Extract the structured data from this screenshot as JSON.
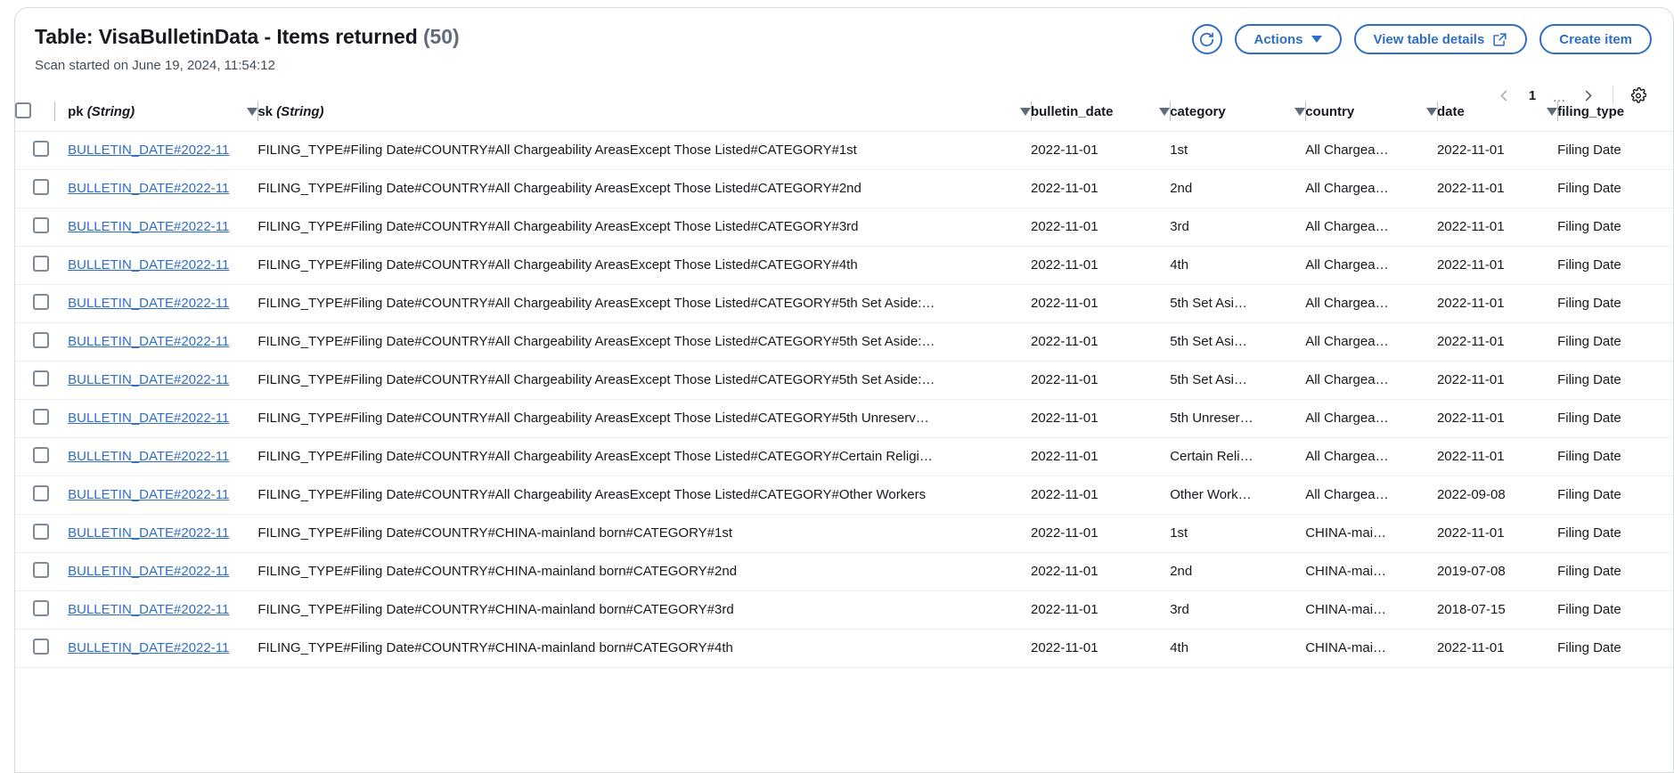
{
  "header": {
    "title_prefix": "Table: VisaBulletinData - Items returned",
    "item_count": "(50)",
    "subtitle": "Scan started on June 19, 2024, 11:54:12",
    "refresh_label": "",
    "actions_label": "Actions",
    "view_table_details_label": "View table details",
    "create_item_label": "Create item"
  },
  "pagination": {
    "prev_label": "",
    "page": "1",
    "ellipsis": "…",
    "next_label": "",
    "settings_label": ""
  },
  "table": {
    "columns": [
      {
        "key": "pk",
        "label": "pk ",
        "type": "(String)"
      },
      {
        "key": "sk",
        "label": "sk ",
        "type": "(String)"
      },
      {
        "key": "bulletin_date",
        "label": "bulletin_date",
        "type": ""
      },
      {
        "key": "category",
        "label": "category",
        "type": ""
      },
      {
        "key": "country",
        "label": "country",
        "type": ""
      },
      {
        "key": "date",
        "label": "date",
        "type": ""
      },
      {
        "key": "filing_type",
        "label": "filing_type",
        "type": ""
      }
    ],
    "rows": [
      {
        "pk": "BULLETIN_DATE#2022-11",
        "sk": "FILING_TYPE#Filing Date#COUNTRY#All Chargeability AreasExcept Those Listed#CATEGORY#1st",
        "bulletin_date": "2022-11-01",
        "category": "1st",
        "country": "All Chargea…",
        "date": "2022-11-01",
        "filing_type": "Filing Date"
      },
      {
        "pk": "BULLETIN_DATE#2022-11",
        "sk": "FILING_TYPE#Filing Date#COUNTRY#All Chargeability AreasExcept Those Listed#CATEGORY#2nd",
        "bulletin_date": "2022-11-01",
        "category": "2nd",
        "country": "All Chargea…",
        "date": "2022-11-01",
        "filing_type": "Filing Date"
      },
      {
        "pk": "BULLETIN_DATE#2022-11",
        "sk": "FILING_TYPE#Filing Date#COUNTRY#All Chargeability AreasExcept Those Listed#CATEGORY#3rd",
        "bulletin_date": "2022-11-01",
        "category": "3rd",
        "country": "All Chargea…",
        "date": "2022-11-01",
        "filing_type": "Filing Date"
      },
      {
        "pk": "BULLETIN_DATE#2022-11",
        "sk": "FILING_TYPE#Filing Date#COUNTRY#All Chargeability AreasExcept Those Listed#CATEGORY#4th",
        "bulletin_date": "2022-11-01",
        "category": "4th",
        "country": "All Chargea…",
        "date": "2022-11-01",
        "filing_type": "Filing Date"
      },
      {
        "pk": "BULLETIN_DATE#2022-11",
        "sk": "FILING_TYPE#Filing Date#COUNTRY#All Chargeability AreasExcept Those Listed#CATEGORY#5th Set Aside:…",
        "bulletin_date": "2022-11-01",
        "category": "5th Set Asi…",
        "country": "All Chargea…",
        "date": "2022-11-01",
        "filing_type": "Filing Date"
      },
      {
        "pk": "BULLETIN_DATE#2022-11",
        "sk": "FILING_TYPE#Filing Date#COUNTRY#All Chargeability AreasExcept Those Listed#CATEGORY#5th Set Aside:…",
        "bulletin_date": "2022-11-01",
        "category": "5th Set Asi…",
        "country": "All Chargea…",
        "date": "2022-11-01",
        "filing_type": "Filing Date"
      },
      {
        "pk": "BULLETIN_DATE#2022-11",
        "sk": "FILING_TYPE#Filing Date#COUNTRY#All Chargeability AreasExcept Those Listed#CATEGORY#5th Set Aside:…",
        "bulletin_date": "2022-11-01",
        "category": "5th Set Asi…",
        "country": "All Chargea…",
        "date": "2022-11-01",
        "filing_type": "Filing Date"
      },
      {
        "pk": "BULLETIN_DATE#2022-11",
        "sk": "FILING_TYPE#Filing Date#COUNTRY#All Chargeability AreasExcept Those Listed#CATEGORY#5th Unreserv…",
        "bulletin_date": "2022-11-01",
        "category": "5th Unreser…",
        "country": "All Chargea…",
        "date": "2022-11-01",
        "filing_type": "Filing Date"
      },
      {
        "pk": "BULLETIN_DATE#2022-11",
        "sk": "FILING_TYPE#Filing Date#COUNTRY#All Chargeability AreasExcept Those Listed#CATEGORY#Certain Religi…",
        "bulletin_date": "2022-11-01",
        "category": "Certain Reli…",
        "country": "All Chargea…",
        "date": "2022-11-01",
        "filing_type": "Filing Date"
      },
      {
        "pk": "BULLETIN_DATE#2022-11",
        "sk": "FILING_TYPE#Filing Date#COUNTRY#All Chargeability AreasExcept Those Listed#CATEGORY#Other Workers",
        "bulletin_date": "2022-11-01",
        "category": "Other Work…",
        "country": "All Chargea…",
        "date": "2022-09-08",
        "filing_type": "Filing Date"
      },
      {
        "pk": "BULLETIN_DATE#2022-11",
        "sk": "FILING_TYPE#Filing Date#COUNTRY#CHINA-mainland born#CATEGORY#1st",
        "bulletin_date": "2022-11-01",
        "category": "1st",
        "country": "CHINA-mai…",
        "date": "2022-11-01",
        "filing_type": "Filing Date"
      },
      {
        "pk": "BULLETIN_DATE#2022-11",
        "sk": "FILING_TYPE#Filing Date#COUNTRY#CHINA-mainland born#CATEGORY#2nd",
        "bulletin_date": "2022-11-01",
        "category": "2nd",
        "country": "CHINA-mai…",
        "date": "2019-07-08",
        "filing_type": "Filing Date"
      },
      {
        "pk": "BULLETIN_DATE#2022-11",
        "sk": "FILING_TYPE#Filing Date#COUNTRY#CHINA-mainland born#CATEGORY#3rd",
        "bulletin_date": "2022-11-01",
        "category": "3rd",
        "country": "CHINA-mai…",
        "date": "2018-07-15",
        "filing_type": "Filing Date"
      },
      {
        "pk": "BULLETIN_DATE#2022-11",
        "sk": "FILING_TYPE#Filing Date#COUNTRY#CHINA-mainland born#CATEGORY#4th",
        "bulletin_date": "2022-11-01",
        "category": "4th",
        "country": "CHINA-mai…",
        "date": "2022-11-01",
        "filing_type": "Filing Date"
      }
    ]
  },
  "colors": {
    "accent": "#2f6ec4",
    "text": "#16191f",
    "muted": "#5f6b7a",
    "border": "#d5dbdb",
    "row_border": "#eceef0"
  }
}
